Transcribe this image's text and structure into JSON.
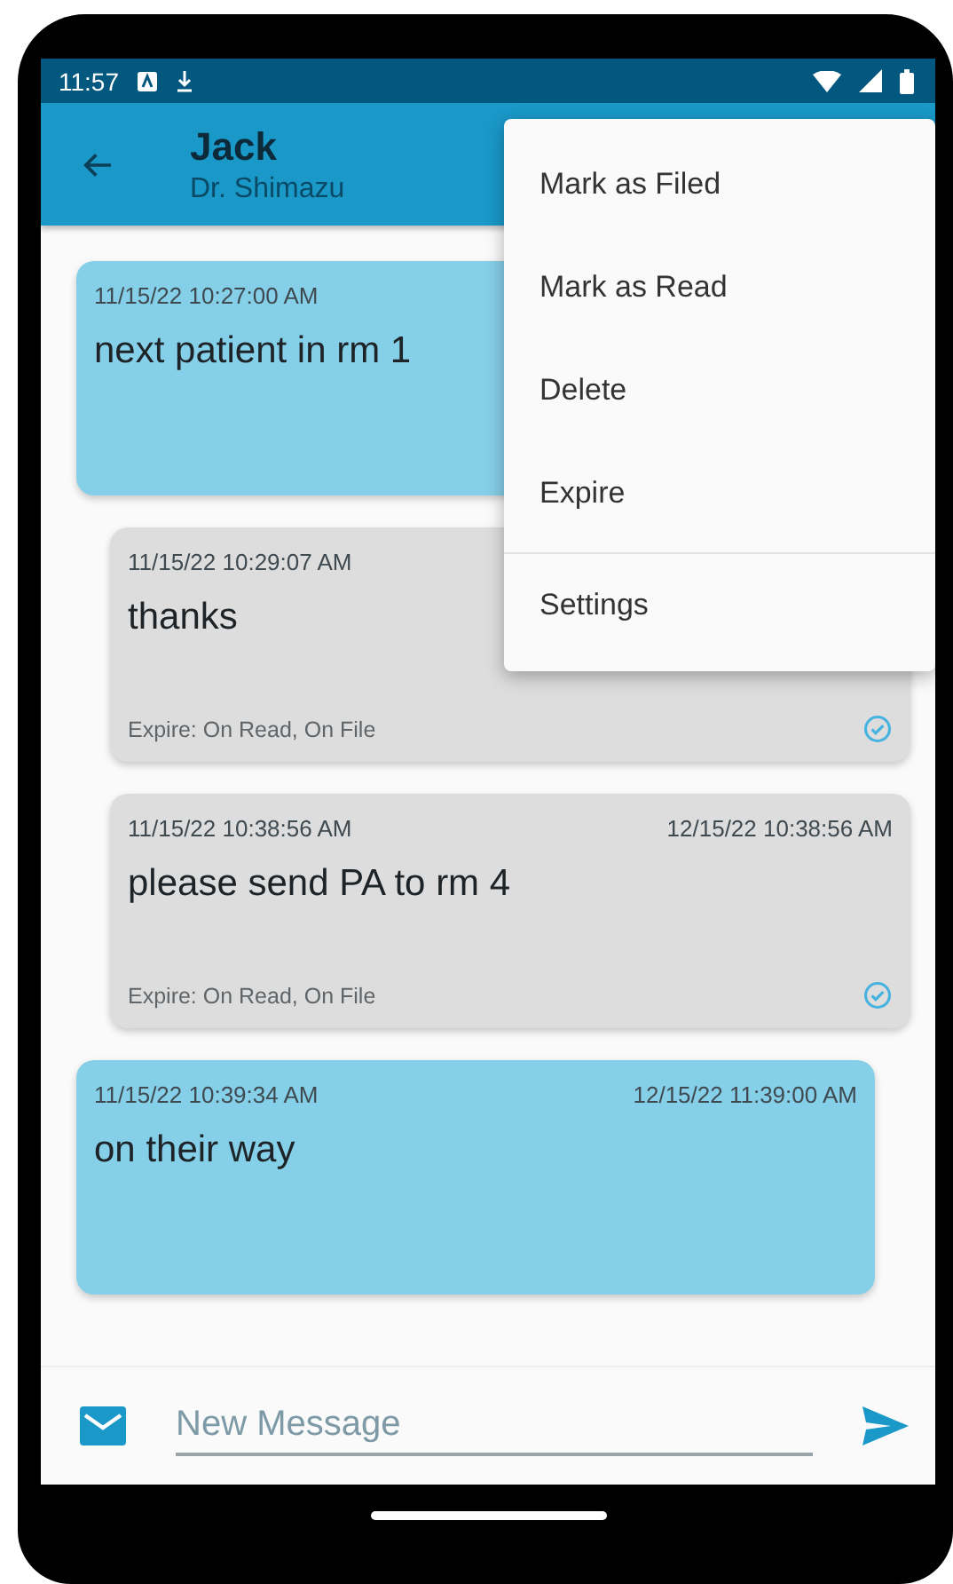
{
  "status_bar": {
    "time": "11:57"
  },
  "app_bar": {
    "title": "Jack",
    "subtitle": "Dr. Shimazu"
  },
  "menu": {
    "groups": [
      [
        "Mark as Filed",
        "Mark as Read",
        "Delete",
        "Expire"
      ],
      [
        "Settings"
      ]
    ]
  },
  "messages": [
    {
      "kind": "sent",
      "sent_at": "11/15/22 10:27:00 AM",
      "text": "next patient in rm 1"
    },
    {
      "kind": "received",
      "sent_at": "11/15/22 10:29:07 AM",
      "text": "thanks",
      "expire": "Expire: On Read, On File",
      "read": true
    },
    {
      "kind": "received",
      "sent_at": "11/15/22 10:38:56 AM",
      "expires_at": "12/15/22 10:38:56 AM",
      "text": "please send PA to rm 4",
      "expire": "Expire: On Read, On File",
      "read": true
    },
    {
      "kind": "sent",
      "sent_at": "11/15/22 10:39:34 AM",
      "expires_at": "12/15/22 11:39:00 AM",
      "text": "on their way"
    }
  ],
  "composer": {
    "placeholder": "New Message"
  }
}
